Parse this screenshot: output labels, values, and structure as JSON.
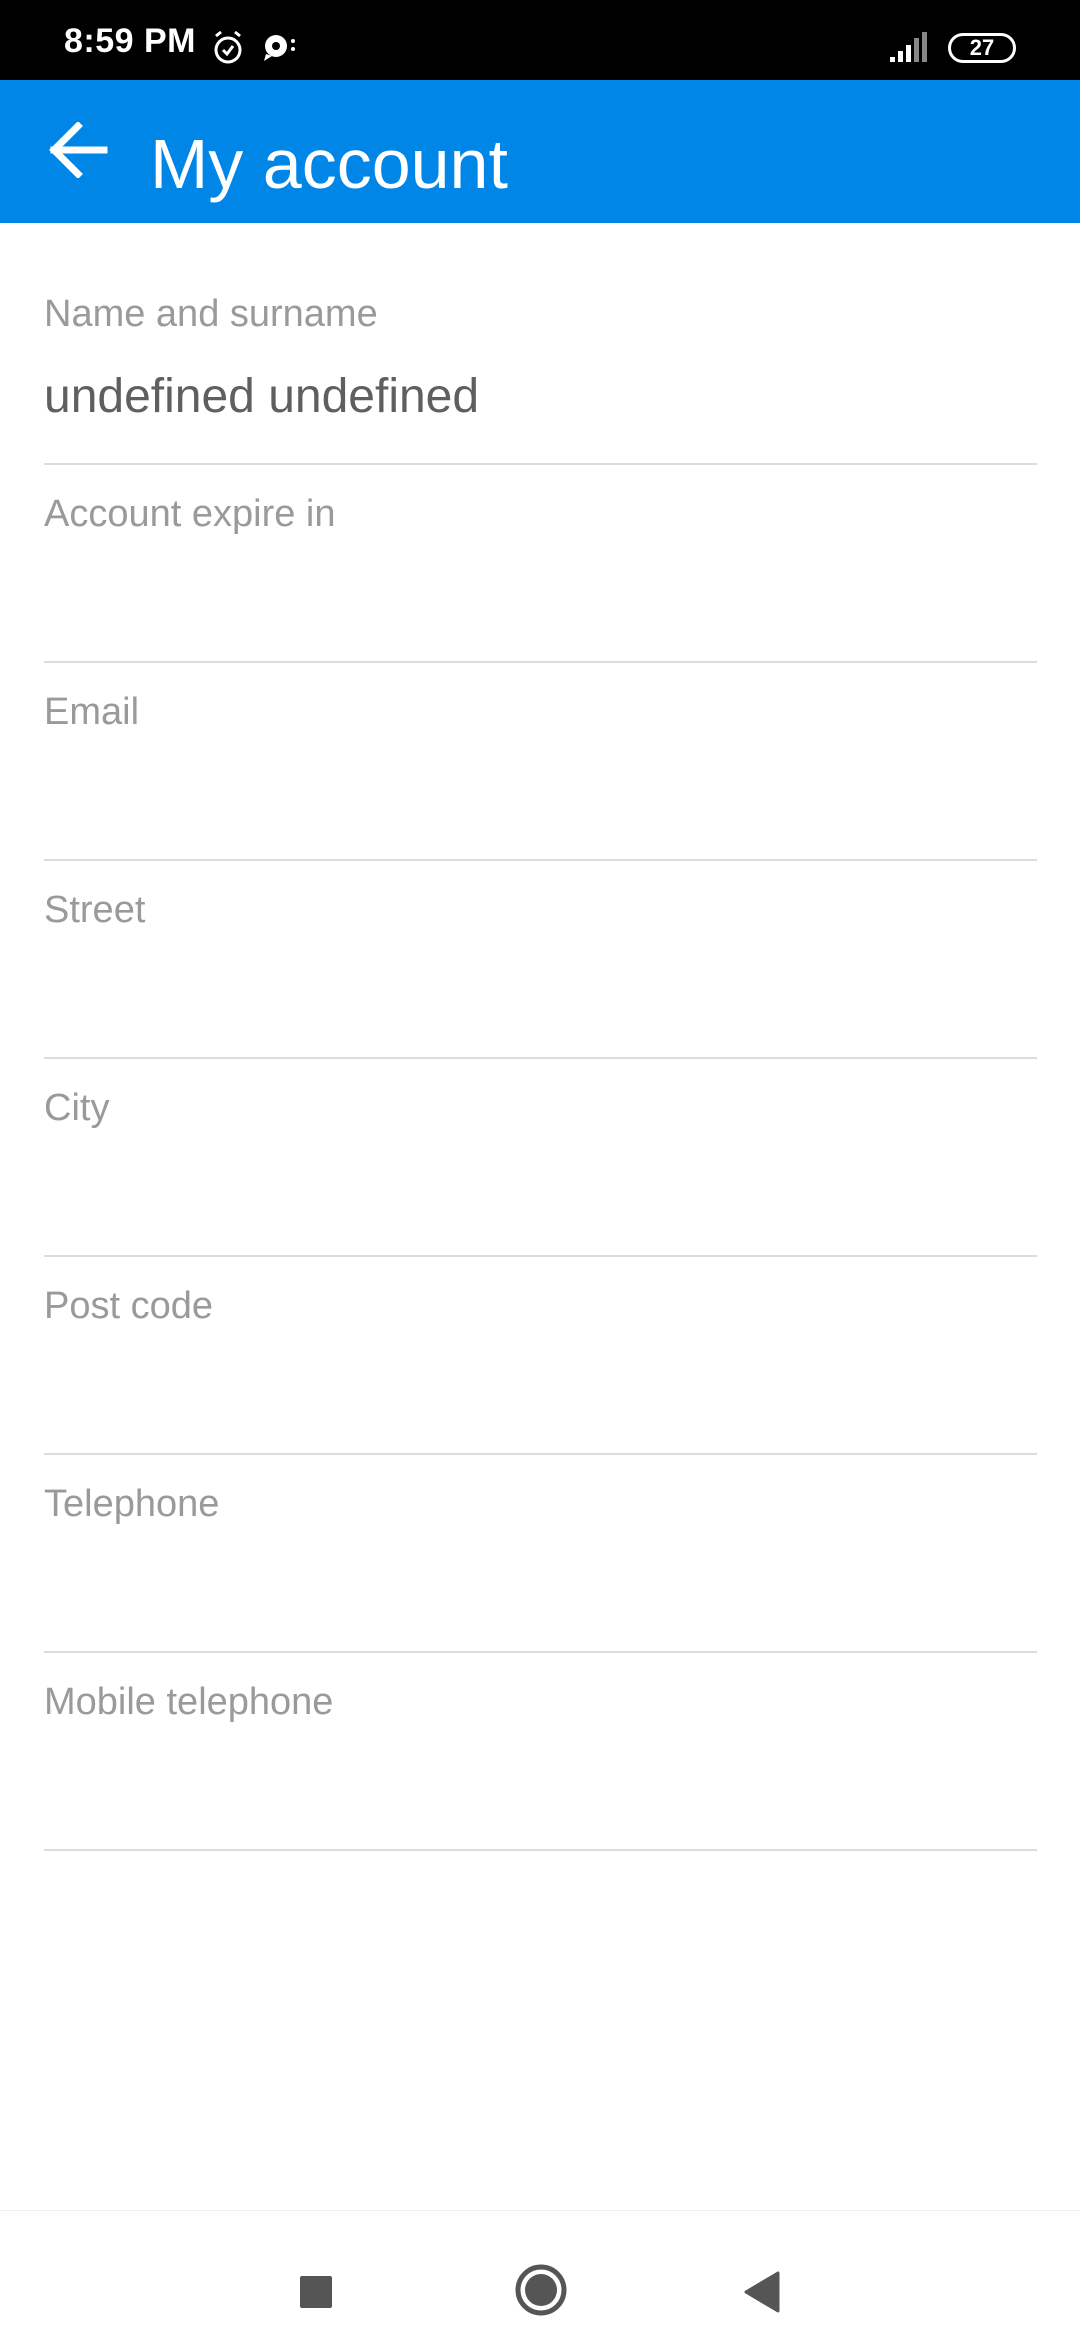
{
  "status_bar": {
    "time": "8:59 PM",
    "battery": "27",
    "icons": [
      "alarm-icon",
      "chat-bubble-icon",
      "signal-icon",
      "battery-icon"
    ]
  },
  "app_bar": {
    "title": "My account",
    "back_icon": "arrow-left-icon",
    "color": "#0086e6"
  },
  "form": {
    "fields": [
      {
        "label": "Name and surname",
        "value": "undefined undefined"
      },
      {
        "label": "Account expire in",
        "value": ""
      },
      {
        "label": "Email",
        "value": ""
      },
      {
        "label": "Street",
        "value": ""
      },
      {
        "label": "City",
        "value": ""
      },
      {
        "label": "Post code",
        "value": ""
      },
      {
        "label": "Telephone",
        "value": ""
      },
      {
        "label": "Mobile telephone",
        "value": ""
      }
    ]
  },
  "nav_bar": {
    "icons": [
      "recents-square-icon",
      "home-circle-icon",
      "back-triangle-icon"
    ]
  }
}
